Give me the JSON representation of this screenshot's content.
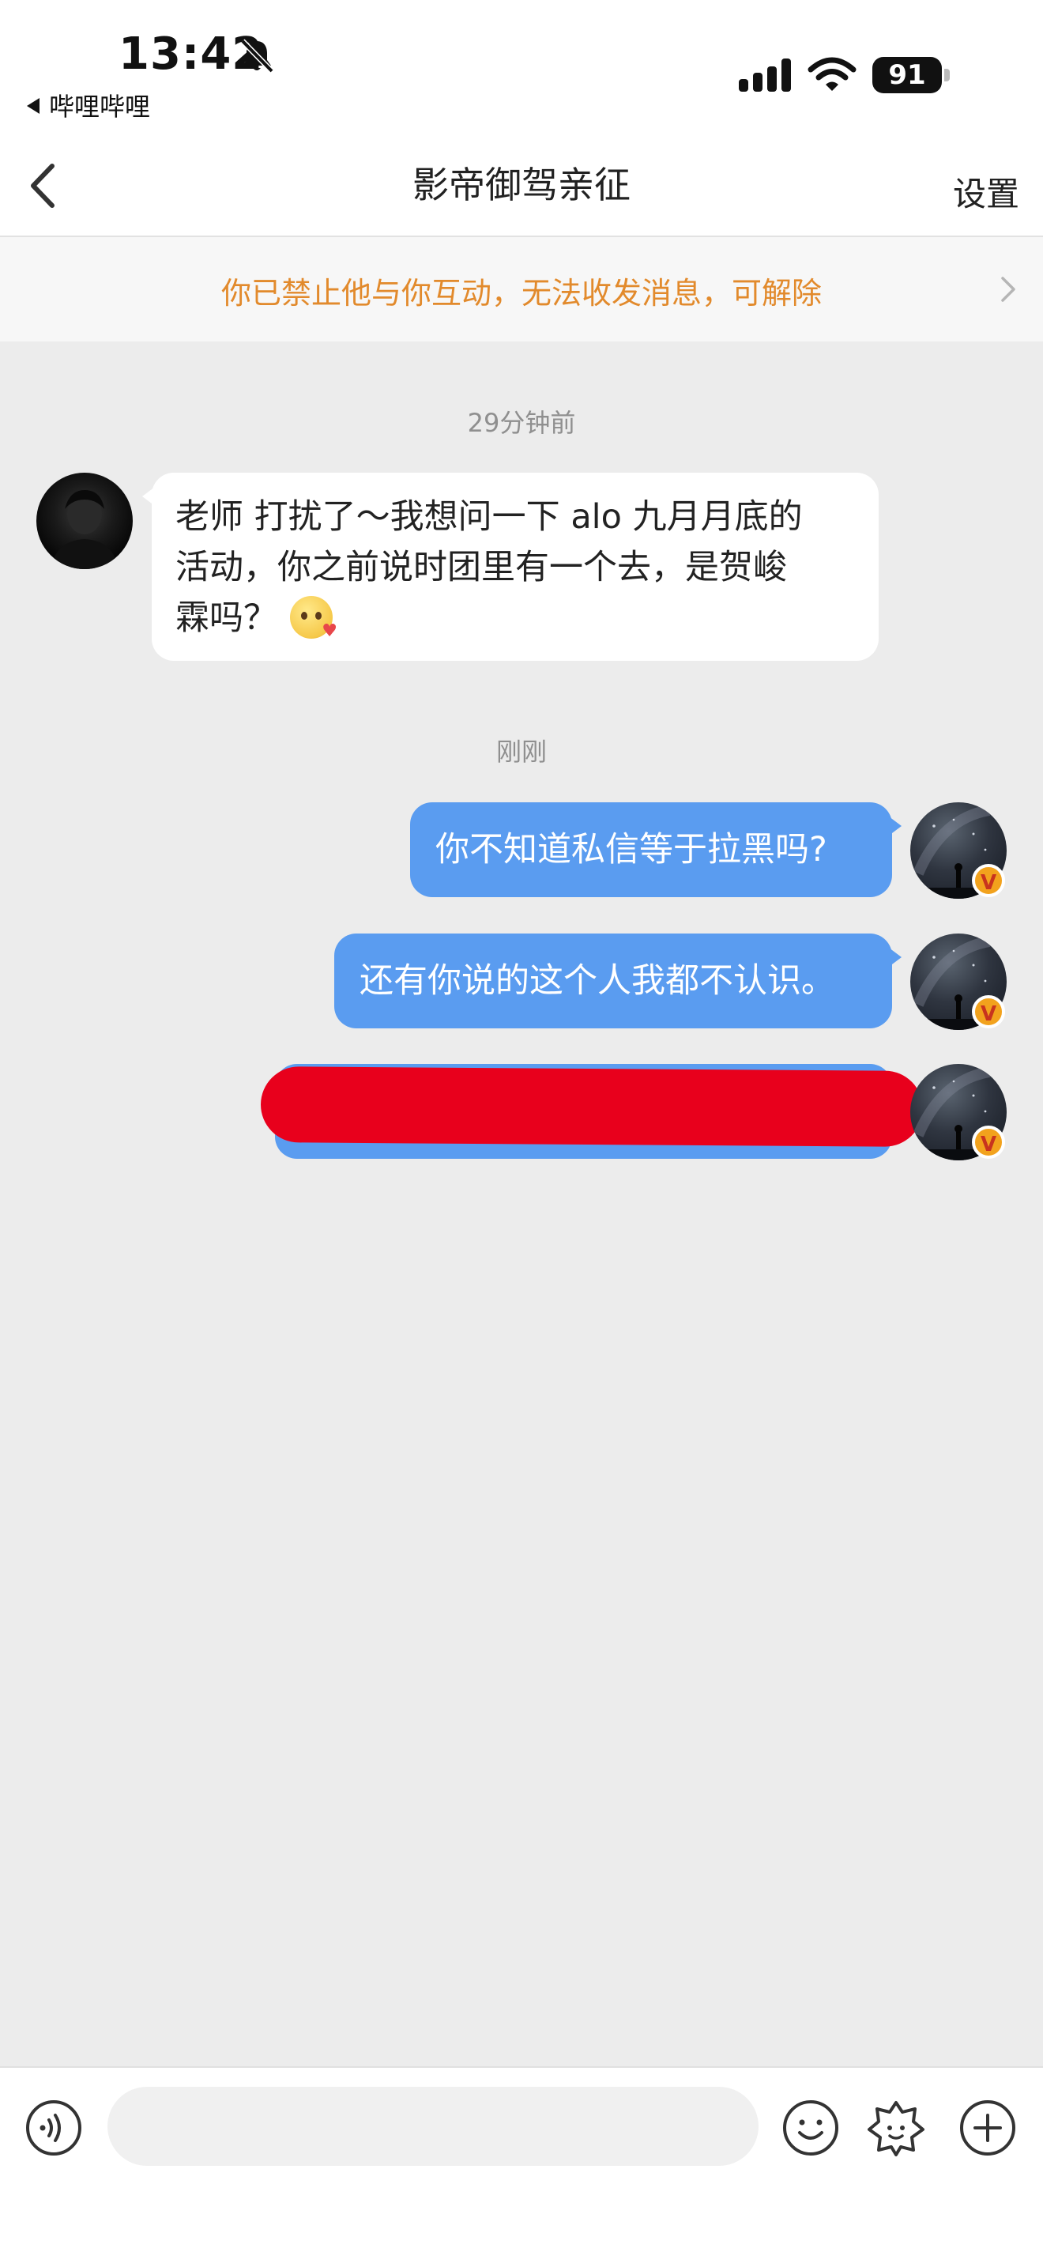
{
  "status_bar": {
    "time": "13:42",
    "back_app_label": "哔哩哔哩",
    "battery_level": "91"
  },
  "header": {
    "title": "影帝御驾亲征",
    "settings_label": "设置"
  },
  "banner": {
    "text": "你已禁止他与你互动，无法收发消息，可解除"
  },
  "chat": {
    "messages": [
      {
        "timestamp": "29分钟前",
        "direction": "incoming",
        "text": "老师 打扰了～我想问一下 alo 九月月底的活动，你之前说时团里有一个去，是贺峻霖吗？"
      },
      {
        "timestamp": "刚刚",
        "direction": "outgoing",
        "text": "你不知道私信等于拉黑吗?"
      },
      {
        "direction": "outgoing",
        "text": "还有你说的这个人我都不认识。"
      },
      {
        "direction": "outgoing",
        "text": "",
        "redacted": true
      }
    ],
    "incoming_line_1": "老师 打扰了～我想问一下 alo 九月月底的",
    "incoming_line_2": "活动，你之前说时团里有一个去，是贺峻",
    "incoming_line_3": "霖吗？",
    "incoming_emoji": "blushing-face-emoji",
    "verified_badge": "V"
  },
  "input_bar": {
    "placeholder": "",
    "icons": [
      "voice-icon",
      "emoji-icon",
      "sticker-icon",
      "plus-icon"
    ]
  },
  "colors": {
    "banner_text": "#e28a2c",
    "outgoing_bubble": "#5a9cf0",
    "incoming_bubble": "#ffffff",
    "chat_background": "#ececec",
    "redaction": "#e8001c",
    "badge": "#f2a21d"
  }
}
